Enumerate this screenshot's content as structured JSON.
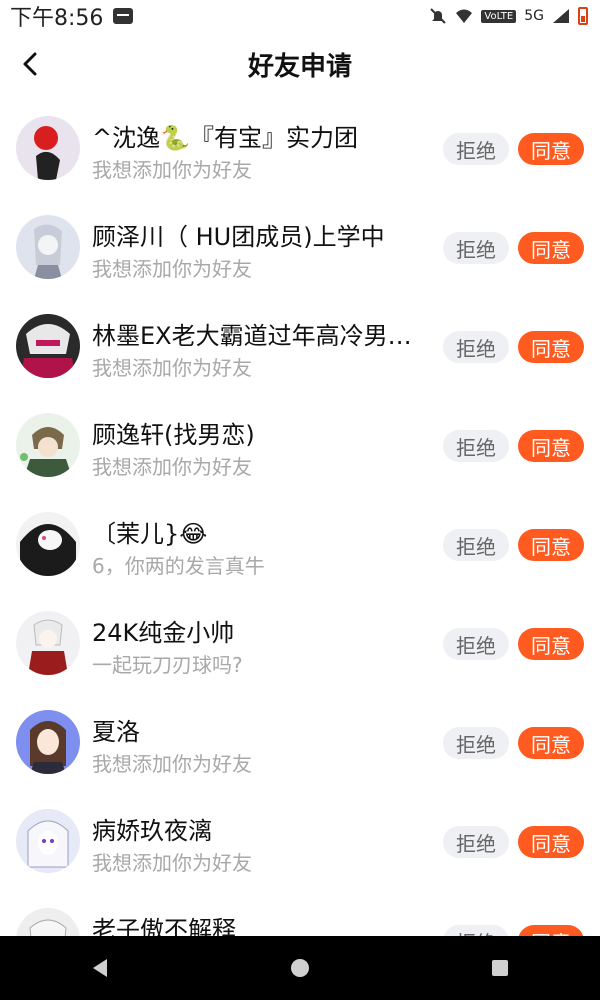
{
  "status_bar": {
    "time": "下午8:56",
    "network": "5G",
    "volte": "VoLTE",
    "icons": [
      "message-icon",
      "bell-off-icon",
      "wifi-icon",
      "signal-icon",
      "battery-icon"
    ]
  },
  "header": {
    "title": "好友申请",
    "back_icon": "chevron-left-icon"
  },
  "buttons": {
    "reject_label": "拒绝",
    "accept_label": "同意"
  },
  "colors": {
    "accept_bg": "#ff5a1f",
    "reject_bg": "#eef0f3",
    "secondary_text": "#a8a8a8"
  },
  "requests": [
    {
      "name": "^沈逸🐍『有宝』实力团",
      "message": "我想添加你为好友"
    },
    {
      "name": "顾泽川（ HU团成员)上学中",
      "message": "我想添加你为好友"
    },
    {
      "name": "林墨EX老大霸道过年高冷男…",
      "message": "我想添加你为好友"
    },
    {
      "name": "顾逸轩(找男恋)",
      "message": "我想添加你为好友"
    },
    {
      "name": "〔茉儿}😂",
      "message": "6，你两的发言真牛"
    },
    {
      "name": "24K纯金小帅",
      "message": "一起玩刀刃球吗?"
    },
    {
      "name": "夏洛",
      "message": "我想添加你为好友"
    },
    {
      "name": "病娇玖夜漓",
      "message": "我想添加你为好友"
    },
    {
      "name": "老子傲不解释",
      "message": ""
    }
  ]
}
